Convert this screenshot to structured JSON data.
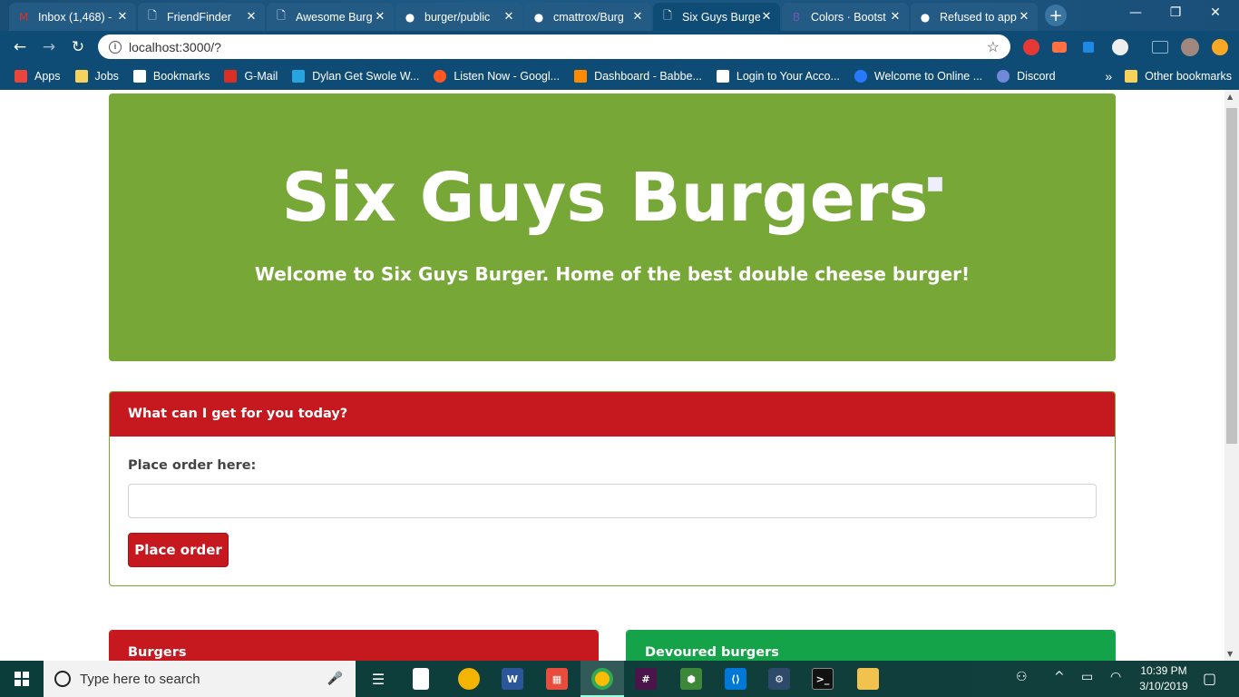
{
  "browser": {
    "tabs": [
      {
        "title": "Inbox (1,468) - ",
        "icon": "gmail-icon",
        "icon_char": "M",
        "icon_color": "#d93025",
        "active": false
      },
      {
        "title": "FriendFinder",
        "icon": "page-icon",
        "icon_char": "🗋",
        "icon_color": "#ffffff",
        "active": false
      },
      {
        "title": "Awesome Burg",
        "icon": "page-icon",
        "icon_char": "🗋",
        "icon_color": "#ffffff",
        "active": false
      },
      {
        "title": "burger/public",
        "icon": "github-icon",
        "icon_char": "●",
        "icon_color": "#ffffff",
        "active": false
      },
      {
        "title": "cmattrox/Burg",
        "icon": "github-icon",
        "icon_char": "●",
        "icon_color": "#ffffff",
        "active": false
      },
      {
        "title": "Six Guys Burge",
        "icon": "page-icon",
        "icon_char": "🗋",
        "icon_color": "#ffffff",
        "active": true
      },
      {
        "title": "Colors · Bootst",
        "icon": "bootstrap-icon",
        "icon_char": "B",
        "icon_color": "#7952b3",
        "active": false
      },
      {
        "title": "Refused to app",
        "icon": "github-icon",
        "icon_char": "●",
        "icon_color": "#ffffff",
        "active": false
      }
    ],
    "tab_close": "✕",
    "new_tab": "+",
    "window_controls": {
      "minimize": "—",
      "restore": "❐",
      "close": "✕"
    },
    "nav": {
      "back": "←",
      "forward": "→",
      "reload": "↻"
    },
    "address": "localhost:3000/?",
    "bookmark_star": "☆",
    "bookmarks": [
      {
        "label": "Apps",
        "icon": "apps-grid-icon",
        "color": "#e8453c"
      },
      {
        "label": "Jobs",
        "icon": "folder-icon",
        "color": "#f7d35b"
      },
      {
        "label": "Bookmarks",
        "icon": "star-icon",
        "color": "#ffffff"
      },
      {
        "label": "G-Mail",
        "icon": "gmail-icon",
        "color": "#d93025"
      },
      {
        "label": "Dylan Get Swole W...",
        "icon": "swirl-icon",
        "color": "#29a3e0"
      },
      {
        "label": "Listen Now - Googl...",
        "icon": "play-music-icon",
        "color": "#ff5722"
      },
      {
        "label": "Dashboard - Babbe...",
        "icon": "babbel-icon",
        "color": "#ff8a00"
      },
      {
        "label": "Login to Your Acco...",
        "icon": "page-icon",
        "color": "#ffffff"
      },
      {
        "label": "Welcome to Online ...",
        "icon": "circle-icon",
        "color": "#2979ff"
      },
      {
        "label": "Discord",
        "icon": "discord-icon",
        "color": "#7289da"
      }
    ],
    "bookmarks_overflow": "»",
    "other_bookmarks": "Other bookmarks"
  },
  "page": {
    "title": "Six Guys Burgers",
    "tagline": "Welcome to Six Guys Burger. Home of the best double cheese burger!",
    "order_card_header": "What can I get for you today?",
    "order_label": "Place order here:",
    "order_input_value": "",
    "order_button": "Place order",
    "burgers_header": "Burgers",
    "devoured_header": "Devoured burgers",
    "colors": {
      "jumbotron": "#76a737",
      "red": "#c5181f",
      "green": "#15a34a"
    }
  },
  "taskbar": {
    "search_placeholder": "Type here to search",
    "time": "10:39 PM",
    "date": "3/10/2019"
  }
}
